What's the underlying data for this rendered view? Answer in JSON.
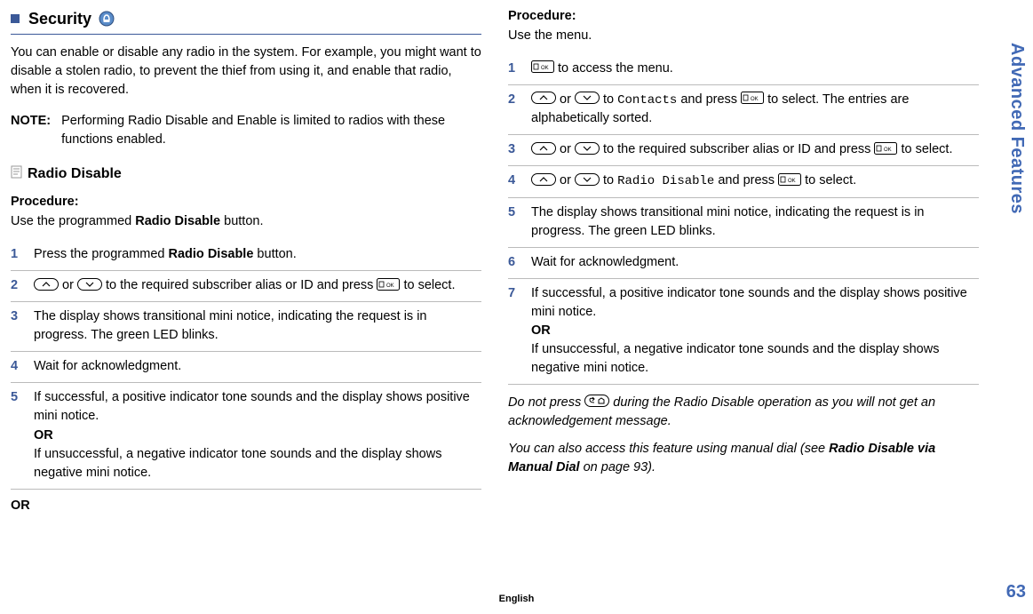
{
  "sideTab": "Advanced Features",
  "pageNumber": "63",
  "englishLabel": "English",
  "left": {
    "sectionTitle": "Security",
    "intro": "You can enable or disable any radio in the system. For example, you might want to disable a stolen radio, to prevent the thief from using it, and enable that radio, when it is recovered.",
    "noteLabel": "NOTE:",
    "noteText": "Performing Radio Disable and Enable is limited to radios with these functions enabled.",
    "subheading": "Radio Disable",
    "procLabel": "Procedure:",
    "procTextA": "Use the programmed ",
    "procTextBold": "Radio Disable",
    "procTextB": " button.",
    "step1a": "Press the programmed ",
    "step1bold": "Radio Disable",
    "step1b": " button.",
    "step2a": " or ",
    "step2b": " to the required subscriber alias or ID and press ",
    "step2c": " to select.",
    "step3": " The display shows transitional mini notice, indicating the request is in progress. The green LED blinks.",
    "step4": "Wait for acknowledgment.",
    "step5a": "If successful, a positive indicator tone sounds and the display shows positive mini notice.",
    "step5or": "OR",
    "step5b": "If unsuccessful, a negative indicator tone sounds and the display shows negative mini notice.",
    "orBottom": "OR"
  },
  "right": {
    "procLabel": "Procedure:",
    "procText": "Use the menu.",
    "step1a": " to access the menu.",
    "step2a": " or ",
    "step2b": " to ",
    "step2mono": "Contacts",
    "step2c": " and press ",
    "step2d": " to select. The entries are alphabetically sorted.",
    "step3a": " or ",
    "step3b": " to the required subscriber alias or ID and press ",
    "step3c": " to select.",
    "step4a": " or ",
    "step4b": " to ",
    "step4mono": "Radio Disable",
    "step4c": " and press ",
    "step4d": " to select.",
    "step5": "The display shows transitional mini notice, indicating the request is in progress. The green LED blinks.",
    "step6": "Wait for acknowledgment.",
    "step7a": "If successful, a positive indicator tone sounds and the display shows positive mini notice.",
    "step7or": "OR",
    "step7b": "If unsuccessful, a negative indicator tone sounds and the display shows negative mini notice.",
    "italicNote1a": "Do not press ",
    "italicNote1b": " during the Radio Disable operation as you will not get an acknowledgement message.",
    "italicNote2a": "You can also access this feature using manual dial (see ",
    "italicNote2bold": "Radio Disable via Manual Dial",
    "italicNote2b": " on page 93)."
  },
  "nums": {
    "n1": "1",
    "n2": "2",
    "n3": "3",
    "n4": "4",
    "n5": "5",
    "n6": "6",
    "n7": "7"
  }
}
